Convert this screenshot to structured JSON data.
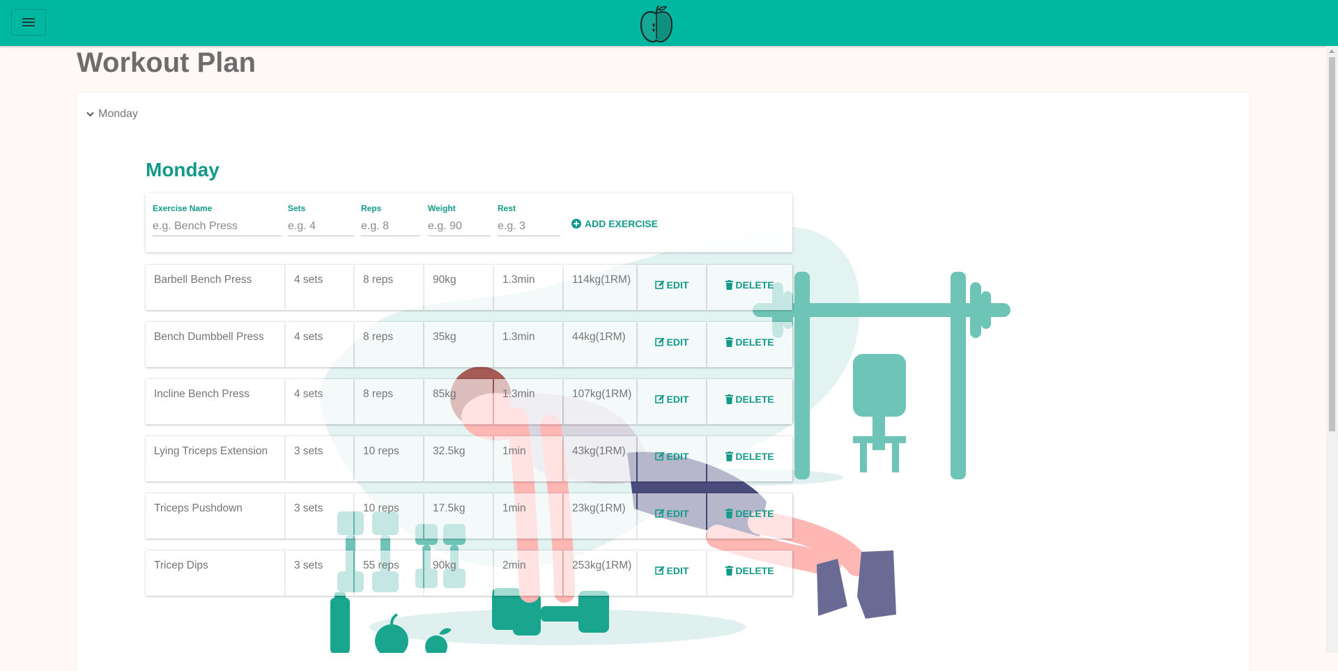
{
  "header": {
    "menu_icon": "hamburger-menu-icon",
    "logo_icon": "apple-logo-icon",
    "brand_color": "#00b8a1"
  },
  "page": {
    "title": "Workout Plan"
  },
  "day_toggle": {
    "label": "Monday",
    "icon": "chevron-down-icon"
  },
  "section": {
    "title": "Monday"
  },
  "form": {
    "fields": [
      {
        "label": "Exercise Name",
        "placeholder": "e.g. Bench Press"
      },
      {
        "label": "Sets",
        "placeholder": "e.g. 4"
      },
      {
        "label": "Reps",
        "placeholder": "e.g. 8"
      },
      {
        "label": "Weight",
        "placeholder": "e.g. 90"
      },
      {
        "label": "Rest",
        "placeholder": "e.g. 3"
      }
    ],
    "add_label": "ADD EXERCISE",
    "add_icon": "plus-circle-icon"
  },
  "actions": {
    "edit_label": "EDIT",
    "delete_label": "DELETE",
    "edit_icon": "edit-icon",
    "delete_icon": "trash-icon"
  },
  "exercises": [
    {
      "name": "Barbell Bench Press",
      "sets": "4 sets",
      "reps": "8 reps",
      "weight": "90kg",
      "rest": "1.3min",
      "one_rm": "114kg(1RM)"
    },
    {
      "name": "Bench Dumbbell Press",
      "sets": "4 sets",
      "reps": "8 reps",
      "weight": "35kg",
      "rest": "1.3min",
      "one_rm": "44kg(1RM)"
    },
    {
      "name": "Incline Bench Press",
      "sets": "4 sets",
      "reps": "8 reps",
      "weight": "85kg",
      "rest": "1.3min",
      "one_rm": "107kg(1RM)"
    },
    {
      "name": "Lying Triceps Extension",
      "sets": "3 sets",
      "reps": "10 reps",
      "weight": "32.5kg",
      "rest": "1min",
      "one_rm": "43kg(1RM)"
    },
    {
      "name": "Triceps Pushdown",
      "sets": "3 sets",
      "reps": "10 reps",
      "weight": "17.5kg",
      "rest": "1min",
      "one_rm": "23kg(1RM)"
    },
    {
      "name": "Tricep Dips",
      "sets": "3 sets",
      "reps": "55 reps",
      "weight": "90kg",
      "rest": "2min",
      "one_rm": "253kg(1RM)"
    }
  ]
}
